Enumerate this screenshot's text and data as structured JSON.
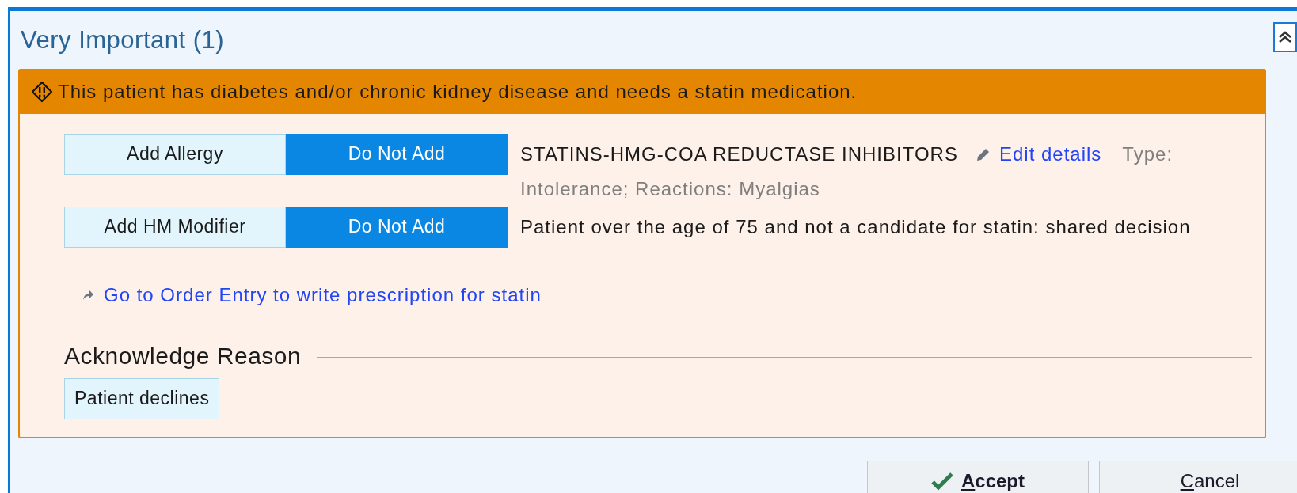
{
  "section": {
    "title": "Very Important (1)",
    "expanded": true
  },
  "alert": {
    "message": "This patient has diabetes and/or chronic kidney disease and needs a statin medication.",
    "actions": [
      {
        "options": [
          {
            "label": "Add Allergy",
            "selected": false
          },
          {
            "label": "Do Not Add",
            "selected": true
          }
        ],
        "description": "STATINS-HMG-COA REDUCTASE INHIBITORS",
        "link": "Edit details",
        "detail_label": "Type:",
        "detail": "Intolerance; Reactions: Myalgias"
      },
      {
        "options": [
          {
            "label": "Add HM Modifier",
            "selected": false
          },
          {
            "label": "Do Not Add",
            "selected": true
          }
        ],
        "description": "Patient over the age of 75 and not a candidate for statin: shared decision"
      }
    ],
    "order_link": "Go to Order Entry to write prescription for statin",
    "acknowledge": {
      "heading": "Acknowledge Reason",
      "reasons": [
        {
          "label": "Patient declines",
          "selected": false
        }
      ]
    }
  },
  "buttons": [
    {
      "label": "Accept",
      "kind": "accept"
    },
    {
      "label": "Cancel",
      "kind": "cancel"
    }
  ]
}
